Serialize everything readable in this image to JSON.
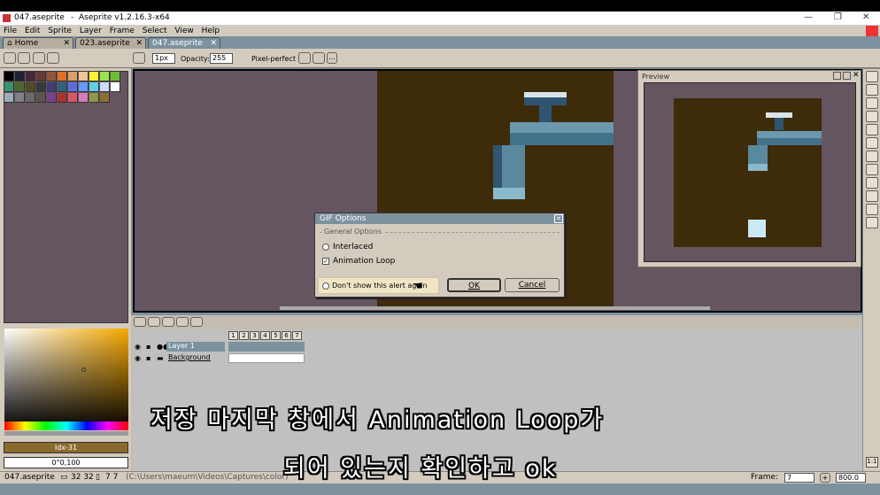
{
  "window": {
    "file_name": "047.aseprite",
    "title": "Aseprite v1.2.16.3-x64",
    "controls": [
      "—",
      "❐",
      "✕"
    ]
  },
  "menu": [
    "File",
    "Edit",
    "Sprite",
    "Layer",
    "Frame",
    "Select",
    "View",
    "Help"
  ],
  "tabs": [
    {
      "label": "Home",
      "active": false
    },
    {
      "label": "023.aseprite",
      "active": false
    },
    {
      "label": "047.aseprite",
      "active": true
    }
  ],
  "toolbar": {
    "brush_size": "1px",
    "opacity_label": "Opacity:",
    "opacity_value": "255",
    "pixel_perfect_label": "Pixel-perfect"
  },
  "preview": {
    "title": "Preview"
  },
  "dialog": {
    "title": "GIF Options",
    "section": "General Options",
    "interlaced_label": "Interlaced",
    "interlaced_checked": false,
    "animation_loop_label": "Animation Loop",
    "animation_loop_checked": true,
    "dont_show_label": "Don't show this alert again",
    "ok_label": "OK",
    "cancel_label": "Cancel"
  },
  "timeline": {
    "frames": [
      "1",
      "2",
      "3",
      "4",
      "5",
      "6",
      "7"
    ],
    "layers": [
      {
        "name": "Layer 1"
      },
      {
        "name": "Background"
      }
    ]
  },
  "left_panel": {
    "index_label": "Idx-31",
    "hsv_label": "0°0,100"
  },
  "status": {
    "file": "047.aseprite",
    "size": "32 32",
    "frames": "7 7",
    "path": "(C:\\Users\\maeum\\Videos\\Captures\\color)",
    "frame_label": "Frame:",
    "frame_value": "7",
    "zoom_value": "800.0",
    "zoom_box": "1:1"
  },
  "subtitles": {
    "line1": "저장 마지막 창에서 Animation Loop가",
    "line2": "되어 있는지 확인하고 ok"
  },
  "colors": {
    "accent": "#7d929f",
    "panel": "#d3cbbe",
    "canvas_bg": "#655560",
    "sprite_bg": "#3d2b0a"
  }
}
